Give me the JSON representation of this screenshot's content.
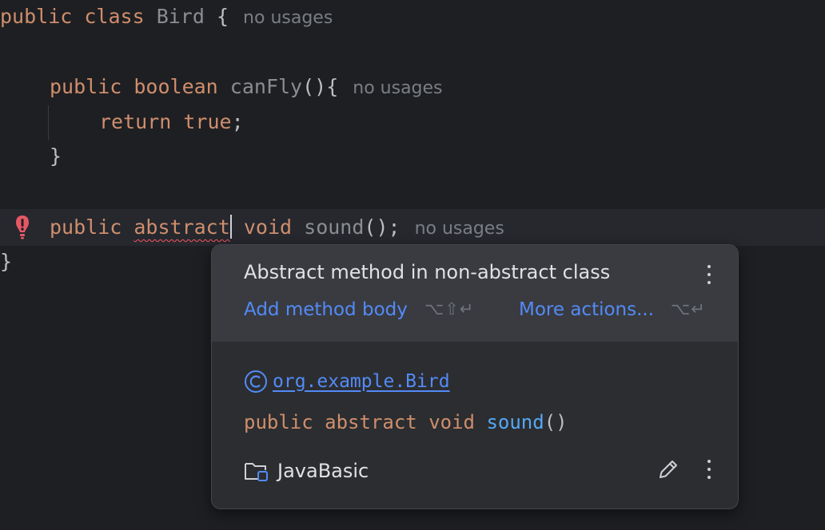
{
  "editor": {
    "line1": {
      "kw1": "public",
      "kw2": "class",
      "name": "Bird",
      "brace": "{",
      "hint": "no usages"
    },
    "line2": {
      "kw1": "public",
      "kw2": "boolean",
      "name": "canFly",
      "rest": "(){",
      "hint": "no usages"
    },
    "line3": {
      "kw1": "return",
      "kw2": "true",
      "rest": ";"
    },
    "line4": {
      "brace": "}"
    },
    "line5": {
      "kw1": "public",
      "kw2": "abstract",
      "kw3": "void",
      "name": "sound",
      "rest": "();",
      "hint": "no usages"
    },
    "line6": {
      "brace": "}"
    }
  },
  "popup": {
    "title": "Abstract method in non-abstract class",
    "action1_label": "Add method body",
    "action1_shortcut": "⌥⇧↵",
    "action2_label": "More actions...",
    "action2_shortcut": "⌥↵",
    "class_ref": "org.example.Bird",
    "signature": {
      "kw1": "public",
      "kw2": "abstract",
      "kw3": "void",
      "method": "sound",
      "parens": "()"
    },
    "module": "JavaBasic"
  },
  "colors": {
    "background": "#1e1f22",
    "keyword": "#cf8e6d",
    "link": "#548af7",
    "error": "#f75464",
    "method": "#56a8f5"
  },
  "icons": [
    "error-icon",
    "kebab-menu-icon",
    "class-icon",
    "folder-module-icon",
    "edit-pencil-icon"
  ]
}
